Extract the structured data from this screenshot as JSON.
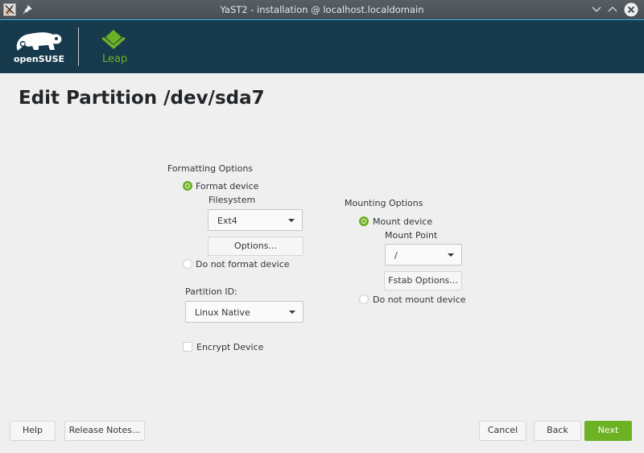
{
  "window": {
    "title": "YaST2 - installation @ localhost.localdomain"
  },
  "header": {
    "brand": "openSUSE",
    "product": "Leap",
    "brand_color": "#173a4d",
    "accent": "#6db125"
  },
  "page": {
    "title": "Edit Partition /dev/sda7"
  },
  "formatting": {
    "group_label": "Formatting Options",
    "format_device": {
      "label": "Format device",
      "selected": true
    },
    "filesystem_label": "Filesystem",
    "filesystem_value": "Ext4",
    "options_button": "Options...",
    "do_not_format": {
      "label": "Do not format device",
      "selected": false
    },
    "partition_id_label": "Partition ID:",
    "partition_id_value": "Linux Native",
    "encrypt": {
      "label": "Encrypt Device",
      "checked": false
    }
  },
  "mounting": {
    "group_label": "Mounting Options",
    "mount_device": {
      "label": "Mount device",
      "selected": true
    },
    "mount_point_label": "Mount Point",
    "mount_point_value": "/",
    "fstab_button": "Fstab Options...",
    "do_not_mount": {
      "label": "Do not mount device",
      "selected": false
    }
  },
  "footer": {
    "help": "Help",
    "release_notes": "Release Notes...",
    "cancel": "Cancel",
    "back": "Back",
    "next": "Next"
  }
}
